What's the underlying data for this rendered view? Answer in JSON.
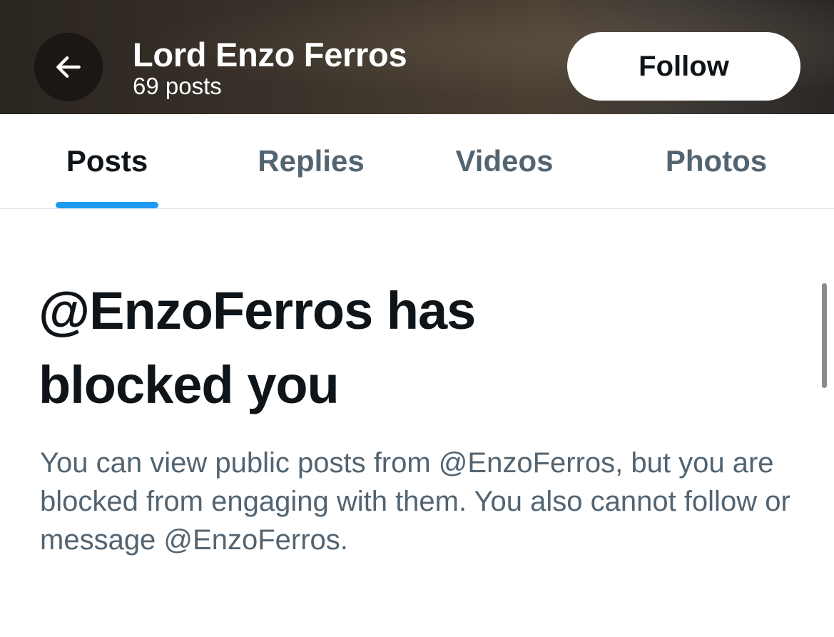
{
  "header": {
    "back_icon": "arrow-left-icon",
    "title": "Lord Enzo Ferros",
    "subtitle": "69 posts",
    "follow_label": "Follow"
  },
  "tabs": [
    {
      "label": "Posts",
      "active": true
    },
    {
      "label": "Replies",
      "active": false
    },
    {
      "label": "Videos",
      "active": false
    },
    {
      "label": "Photos",
      "active": false
    }
  ],
  "main": {
    "title": "@EnzoFerros has blocked you",
    "message": "You can view public posts from @EnzoFerros, but you are blocked from engaging with them. You also cannot follow or message @EnzoFerros."
  },
  "colors": {
    "accent": "#1d9bf0",
    "text_primary": "#0f1419",
    "text_secondary": "#536471"
  }
}
